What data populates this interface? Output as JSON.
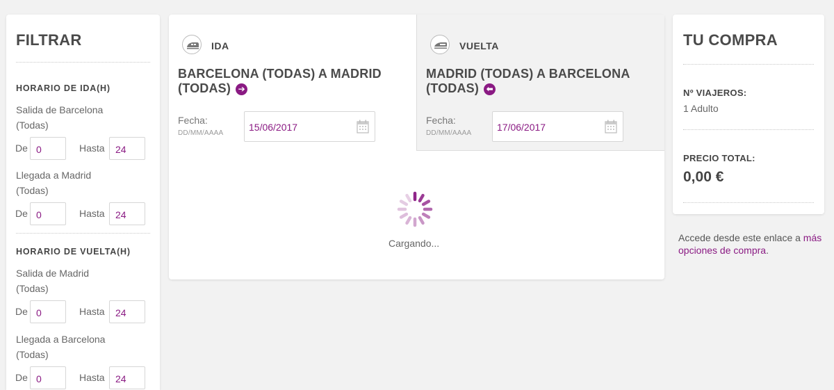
{
  "filter": {
    "title": "FILTRAR",
    "ida": {
      "section_title": "HORARIO DE IDA(H)",
      "salida_label": "Salida de Barcelona (Todas)",
      "salida_from_label": "De",
      "salida_from_value": "0",
      "salida_to_label": "Hasta",
      "salida_to_value": "24",
      "llegada_label": "Llegada a Madrid (Todas)",
      "llegada_from_label": "De",
      "llegada_from_value": "0",
      "llegada_to_label": "Hasta",
      "llegada_to_value": "24"
    },
    "vuelta": {
      "section_title": "HORARIO DE VUELTA(H)",
      "salida_label": "Salida de Madrid (Todas)",
      "salida_from_label": "De",
      "salida_from_value": "0",
      "salida_to_label": "Hasta",
      "salida_to_value": "24",
      "llegada_label": "Llegada a Barcelona (Todas)",
      "llegada_from_label": "De",
      "llegada_from_value": "0",
      "llegada_to_label": "Hasta",
      "llegada_to_value": "24"
    }
  },
  "tabs": {
    "ida": {
      "label": "IDA",
      "route": "BARCELONA (TODAS) A MADRID (TODAS)",
      "route_arrow_icon": "arrow-right-circle-icon",
      "fecha_label": "Fecha:",
      "fecha_hint": "DD/MM/AAAA",
      "date_value": "15/06/2017"
    },
    "vuelta": {
      "label": "VUELTA",
      "route": "MADRID (TODAS) A BARCELONA (TODAS)",
      "route_arrow_icon": "arrow-left-circle-icon",
      "fecha_label": "Fecha:",
      "fecha_hint": "DD/MM/AAAA",
      "date_value": "17/06/2017"
    }
  },
  "loading": {
    "text": "Cargando..."
  },
  "compra": {
    "title": "TU COMPRA",
    "viajeros_label": "Nº VIAJEROS:",
    "viajeros_value": "1 Adulto",
    "precio_label": "PRECIO TOTAL:",
    "precio_value": "0,00 €"
  },
  "more_options": {
    "text": "Accede desde este enlace a",
    "link": "más opciones de compra",
    "suffix": "."
  },
  "colors": {
    "accent": "#8a1a83",
    "background": "#f2f2f2",
    "card": "#ffffff"
  }
}
